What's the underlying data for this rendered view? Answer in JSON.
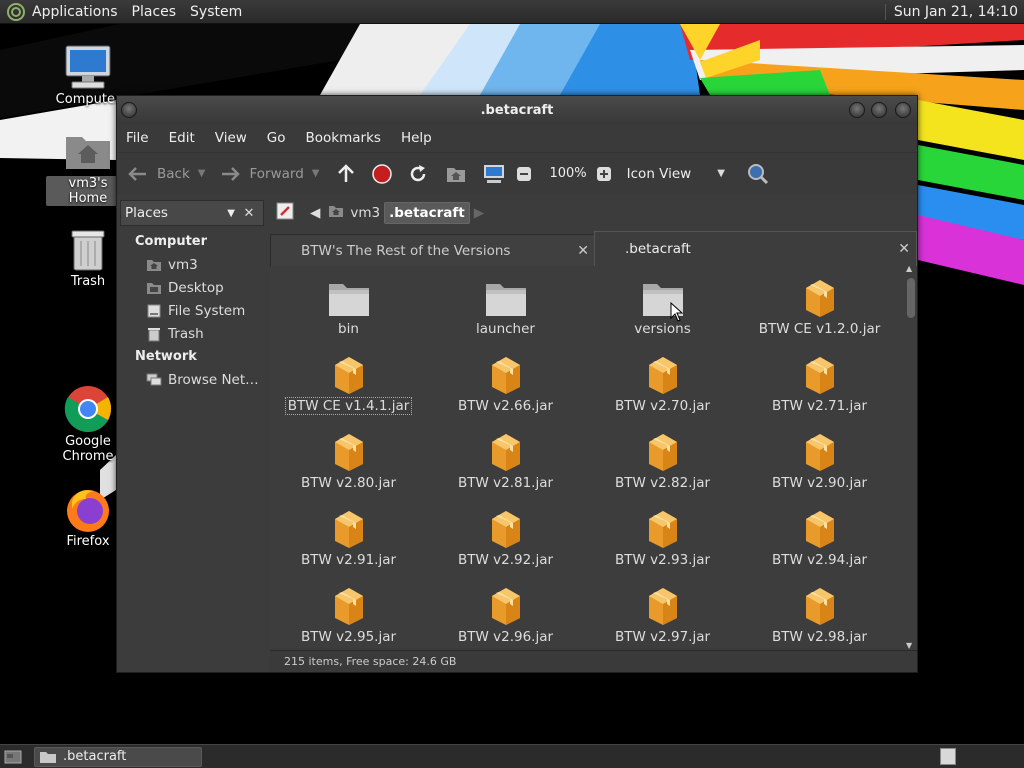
{
  "top_panel": {
    "menus": [
      "Applications",
      "Places",
      "System"
    ],
    "clock": "Sun Jan 21, 14:10"
  },
  "desktop_icons": [
    {
      "label": "Computer",
      "icon": "computer-icon"
    },
    {
      "label": "vm3's Home",
      "icon": "home-folder-icon"
    },
    {
      "label": "Trash",
      "icon": "trash-icon"
    },
    {
      "label": "Google Chrome",
      "icon": "chrome-icon"
    },
    {
      "label": "Firefox",
      "icon": "firefox-icon"
    }
  ],
  "window": {
    "title": ".betacraft",
    "menu": [
      "File",
      "Edit",
      "View",
      "Go",
      "Bookmarks",
      "Help"
    ],
    "toolbar": {
      "back": "Back",
      "forward": "Forward",
      "zoom": "100%",
      "view_mode": "Icon View"
    },
    "places_label": "Places",
    "sidebar": {
      "computer_header": "Computer",
      "computer_items": [
        "vm3",
        "Desktop",
        "File System",
        "Trash"
      ],
      "network_header": "Network",
      "network_items": [
        "Browse Net…"
      ]
    },
    "path": [
      "vm3",
      ".betacraft"
    ],
    "tabs": [
      {
        "label": "BTW's The Rest of the Versions",
        "active": false
      },
      {
        "label": ".betacraft",
        "active": true
      }
    ],
    "files": [
      {
        "name": "bin",
        "type": "folder"
      },
      {
        "name": "launcher",
        "type": "folder"
      },
      {
        "name": "versions",
        "type": "folder"
      },
      {
        "name": "BTW CE v1.2.0.jar",
        "type": "jar"
      },
      {
        "name": "BTW CE v1.4.1.jar",
        "type": "jar",
        "focused": true
      },
      {
        "name": "BTW v2.66.jar",
        "type": "jar"
      },
      {
        "name": "BTW v2.70.jar",
        "type": "jar"
      },
      {
        "name": "BTW v2.71.jar",
        "type": "jar"
      },
      {
        "name": "BTW v2.80.jar",
        "type": "jar"
      },
      {
        "name": "BTW v2.81.jar",
        "type": "jar"
      },
      {
        "name": "BTW v2.82.jar",
        "type": "jar"
      },
      {
        "name": "BTW v2.90.jar",
        "type": "jar"
      },
      {
        "name": "BTW v2.91.jar",
        "type": "jar"
      },
      {
        "name": "BTW v2.92.jar",
        "type": "jar"
      },
      {
        "name": "BTW v2.93.jar",
        "type": "jar"
      },
      {
        "name": "BTW v2.94.jar",
        "type": "jar"
      },
      {
        "name": "BTW v2.95.jar",
        "type": "jar"
      },
      {
        "name": "BTW v2.96.jar",
        "type": "jar"
      },
      {
        "name": "BTW v2.97.jar",
        "type": "jar"
      },
      {
        "name": "BTW v2.98.jar",
        "type": "jar"
      }
    ],
    "status": "215 items, Free space: 24.6 GB"
  },
  "taskbar": {
    "tasks": [
      ".betacraft"
    ]
  }
}
